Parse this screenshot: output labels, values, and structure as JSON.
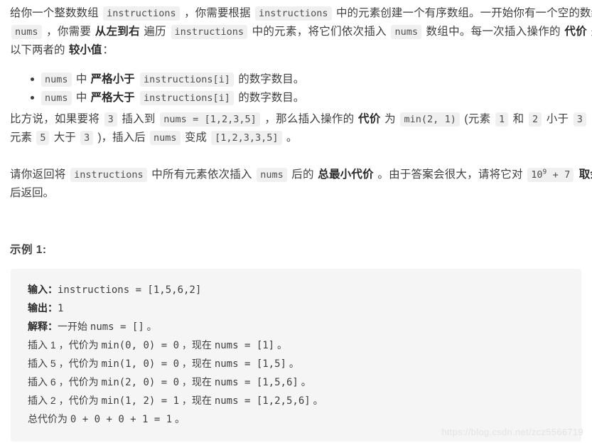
{
  "meta": {
    "watermark": "https://blog.csdn.net/zcz5566719",
    "accent_inline_code_bg": "#f0f0f0",
    "code_block_bg": "#f5f5f5",
    "text_color": "#3f3f3f"
  },
  "problem": {
    "p1": {
      "t1": "给你一个整数数组 ",
      "c1": "instructions",
      "t2": " ，你需要根据 ",
      "c2": "instructions",
      "t3": " 中的元素创建一个有序数组。一开始你有一个空的数组 ",
      "c3": "nums",
      "t4": " ，你需要 ",
      "b1": "从左到右",
      "t5": " 遍历 ",
      "c4": "instructions",
      "t6": " 中的元素，将它们依次插入 ",
      "c5": "nums",
      "t7": " 数组中。每一次插入操作的 ",
      "b2": "代价",
      "t8": " 是以下两者的 ",
      "b3": "较小值",
      "t9": "："
    },
    "bullets": [
      {
        "c1": "nums",
        "t1": " 中 ",
        "b1": "严格小于",
        "t2": " ",
        "c2": "instructions[i]",
        "t3": " 的数字数目。"
      },
      {
        "c1": "nums",
        "t1": " 中 ",
        "b1": "严格大于",
        "t2": " ",
        "c2": "instructions[i]",
        "t3": " 的数字数目。"
      }
    ],
    "p2": {
      "t1": "比方说，如果要将 ",
      "c1": "3",
      "t2": " 插入到 ",
      "c2": "nums = [1,2,3,5]",
      "t3": " ，那么插入操作的 ",
      "b1": "代价",
      "t4": " 为 ",
      "c3": "min(2, 1)",
      "t5": " (元素 ",
      "c4": "1",
      "t6": " 和 ",
      "c5": "2",
      "t7": " 小于 ",
      "c6": "3",
      "t8": " ，元素 ",
      "c7": "5",
      "t9": " 大于 ",
      "c8": "3",
      "t10": " )，插入后 ",
      "c9": "nums",
      "t11": " 变成 ",
      "c10": "[1,2,3,3,5]",
      "t12": " 。"
    },
    "p3": {
      "t1": "请你返回将 ",
      "c1": "instructions",
      "t2": " 中所有元素依次插入 ",
      "c2": "nums",
      "t3": " 后的 ",
      "b1": "总最小代价",
      "t4": " 。由于答案会很大，请将它对 ",
      "c3_base": "10",
      "c3_sup": "9",
      "c3_tail": " + 7",
      "t5": " ",
      "b2": "取余",
      "t6": " 后返回。"
    }
  },
  "example": {
    "title": "示例 1:",
    "lines": [
      {
        "label": "输入：",
        "code": "instructions = [1,5,6,2]"
      },
      {
        "label": "输出：",
        "code": "1"
      },
      {
        "label": "解释：",
        "cn_a": "一开始 ",
        "code": "nums = []",
        "cn_b": " 。"
      },
      {
        "label": "",
        "cn_a": "插入 1 ，代价为 ",
        "code": "min(0, 0) = 0",
        "cn_b": " ，现在 ",
        "code2": "nums = [1]",
        "cn_c": " 。"
      },
      {
        "label": "",
        "cn_a": "插入 5 ，代价为 ",
        "code": "min(1, 0) = 0",
        "cn_b": " ，现在 ",
        "code2": "nums = [1,5]",
        "cn_c": " 。"
      },
      {
        "label": "",
        "cn_a": "插入 6 ，代价为 ",
        "code": "min(2, 0) = 0",
        "cn_b": " ，现在 ",
        "code2": "nums = [1,5,6]",
        "cn_c": " 。"
      },
      {
        "label": "",
        "cn_a": "插入 2 ，代价为 ",
        "code": "min(1, 2) = 1",
        "cn_b": " ，现在 ",
        "code2": "nums = [1,2,5,6]",
        "cn_c": " 。"
      },
      {
        "label": "",
        "cn_a": "总代价为 ",
        "code": "0 + 0 + 0 + 1 = 1",
        "cn_b": " 。"
      }
    ]
  }
}
